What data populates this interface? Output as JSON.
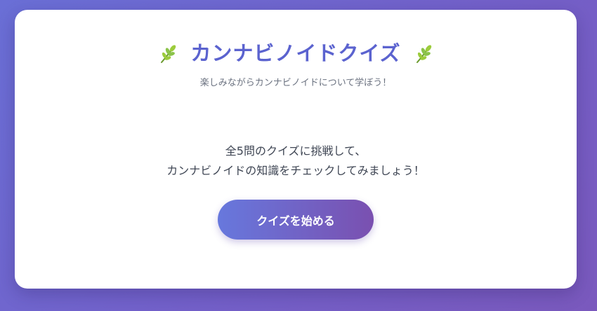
{
  "header": {
    "title": "カンナビノイドクイズ",
    "subtitle": "楽しみながらカンナビノイドについて学ぼう！",
    "left_icon": "herb-icon",
    "right_icon": "herb-icon"
  },
  "intro": {
    "line1": "全5問のクイズに挑戦して、",
    "line2": "カンナビノイドの知識をチェックしてみましょう！"
  },
  "start_button": {
    "label": "クイズを始める"
  },
  "colors": {
    "background_start": "#6a6fd6",
    "background_end": "#7a59bd",
    "title": "#5b63cf",
    "button_start": "#6778dd",
    "button_end": "#7a50b0"
  }
}
